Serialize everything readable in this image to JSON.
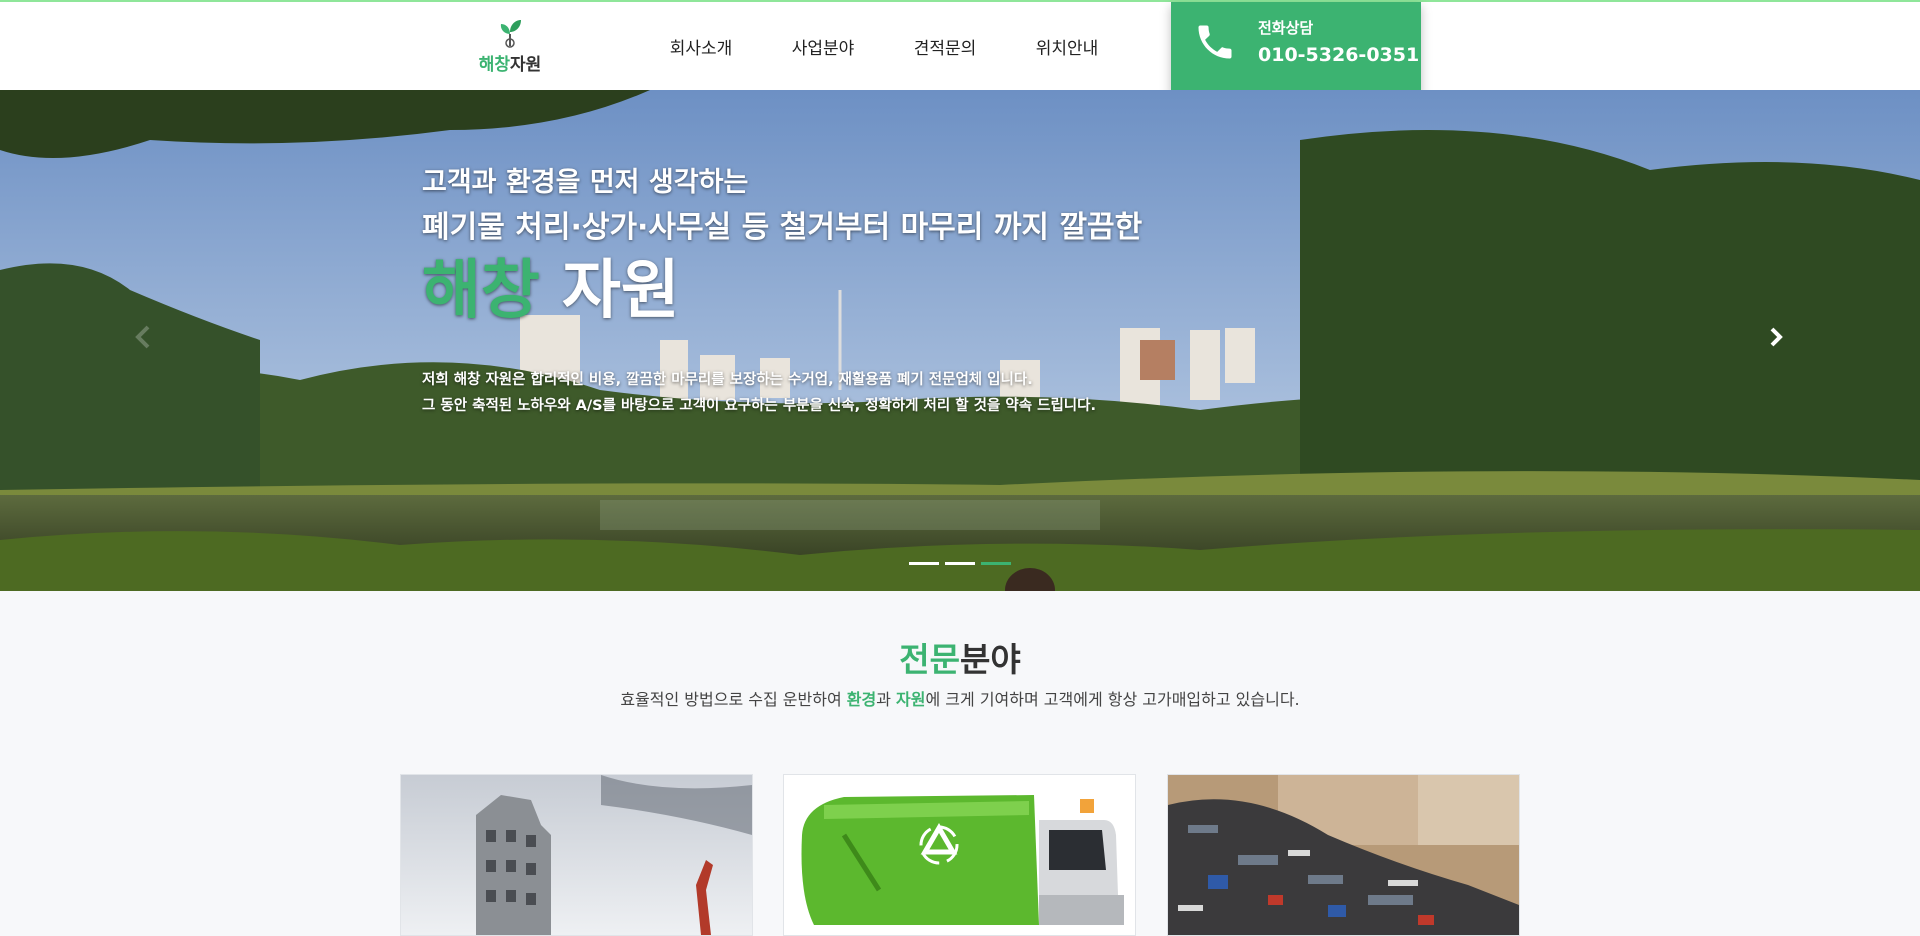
{
  "header": {
    "logo_brand_green": "해창",
    "logo_brand_dark": "자원",
    "nav": [
      "회사소개",
      "사업분야",
      "견적문의",
      "위치안내"
    ],
    "call_label": "전화상담",
    "call_number": "010-5326-0351"
  },
  "hero": {
    "line1": "고객과 환경을 먼저 생각하는",
    "line2": "폐기물 처리·상가·사무실 등 철거부터 마무리 까지 깔끔한",
    "brand_green": "해창",
    "brand_white": "자원",
    "para1": "저희 해창 자원은 합리적인 비용, 깔끔한 마무리를 보장하는 수거업, 재활용품 폐기 전문업체 입니다.",
    "para2": "그 동안 축적된 노하우와 A/S를 바탕으로 고객이 요구하는 부분을 신속, 정확하게 처리 할 것을 약속 드립니다.",
    "slides": 3,
    "active_slide": 3
  },
  "specialty": {
    "title_green": "전문",
    "title_dark": "분야",
    "desc_part1": "효율적인 방법으로 수집 운반하여 ",
    "desc_green1": "환경",
    "desc_part2": "과 ",
    "desc_green2": "자원",
    "desc_part3": "에 크게 기여하며 고객에게 항상 고가매입하고 있습니다.",
    "cards": [
      "building-demolition-image",
      "garbage-truck-image",
      "scrap-pile-image"
    ]
  },
  "colors": {
    "accent": "#3cb371",
    "topline": "#8fe69a"
  }
}
